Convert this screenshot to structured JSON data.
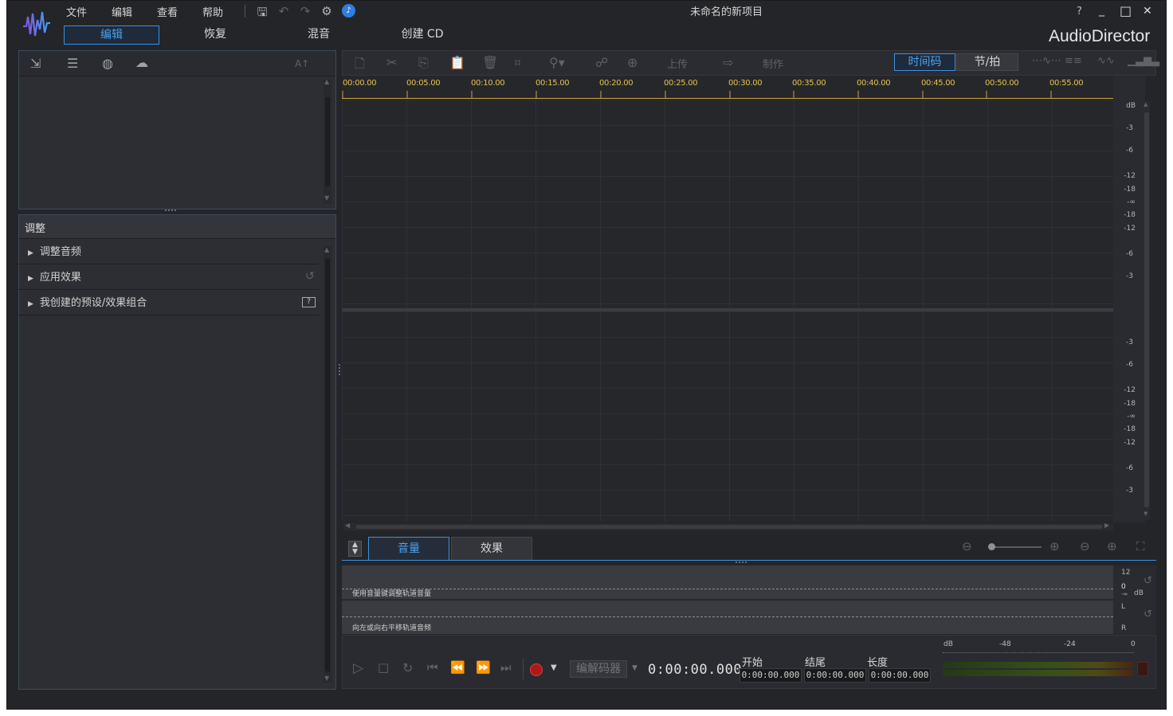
{
  "window": {
    "title": "未命名的新项目",
    "brand": "AudioDirector",
    "help": "?",
    "minimize": "_",
    "maximize": "□",
    "close": "✕"
  },
  "menu": {
    "file": "文件",
    "edit": "编辑",
    "view": "查看",
    "help": "帮助"
  },
  "tabs": {
    "edit": "编辑",
    "restore": "恢复",
    "mix": "混音",
    "cd": "创建 CD"
  },
  "library": {
    "font_btn": "A↑"
  },
  "adjust": {
    "title": "调整",
    "items": [
      "调整音频",
      "应用效果",
      "我创建的预设/效果组合"
    ]
  },
  "toolbar": {
    "upload": "上传",
    "produce": "制作",
    "timecode": "时间码",
    "beat": "节/拍"
  },
  "ruler": [
    "00:00.00",
    "00:05.00",
    "00:10.00",
    "00:15.00",
    "00:20.00",
    "00:25.00",
    "00:30.00",
    "00:35.00",
    "00:40.00",
    "00:45.00",
    "00:50.00",
    "00:55.00"
  ],
  "db_scale": {
    "unit": "dB",
    "track1": [
      "-3",
      "-6",
      "-12",
      "-18",
      "-∞",
      "-18",
      "-12",
      "-6",
      "-3"
    ],
    "track2": [
      "-3",
      "-6",
      "-12",
      "-18",
      "-∞",
      "-18",
      "-12",
      "-6",
      "-3"
    ]
  },
  "bottom_tabs": {
    "volume": "音量",
    "effects": "效果"
  },
  "volume_panel": {
    "hint_volume": "使用音量键调整轨道音量",
    "hint_pan": "向左或向右平移轨道音频",
    "scale_12": "12",
    "scale_0": "0",
    "scale_inf": "-∞",
    "scale_db": "dB",
    "left": "L",
    "right": "R"
  },
  "transport": {
    "codec": "编解码器",
    "time": "0:00:00.000",
    "start_label": "开始",
    "end_label": "结尾",
    "length_label": "长度",
    "start": "0:00:00.000",
    "end": "0:00:00.000",
    "length": "0:00:00.000"
  },
  "meter": {
    "labels": [
      "dB",
      "-48",
      "-24",
      "0"
    ]
  },
  "colors": {
    "accent": "#3e8fde",
    "ruler": "#e3c34a",
    "bg": "#242529",
    "panel": "#2d2e33"
  }
}
